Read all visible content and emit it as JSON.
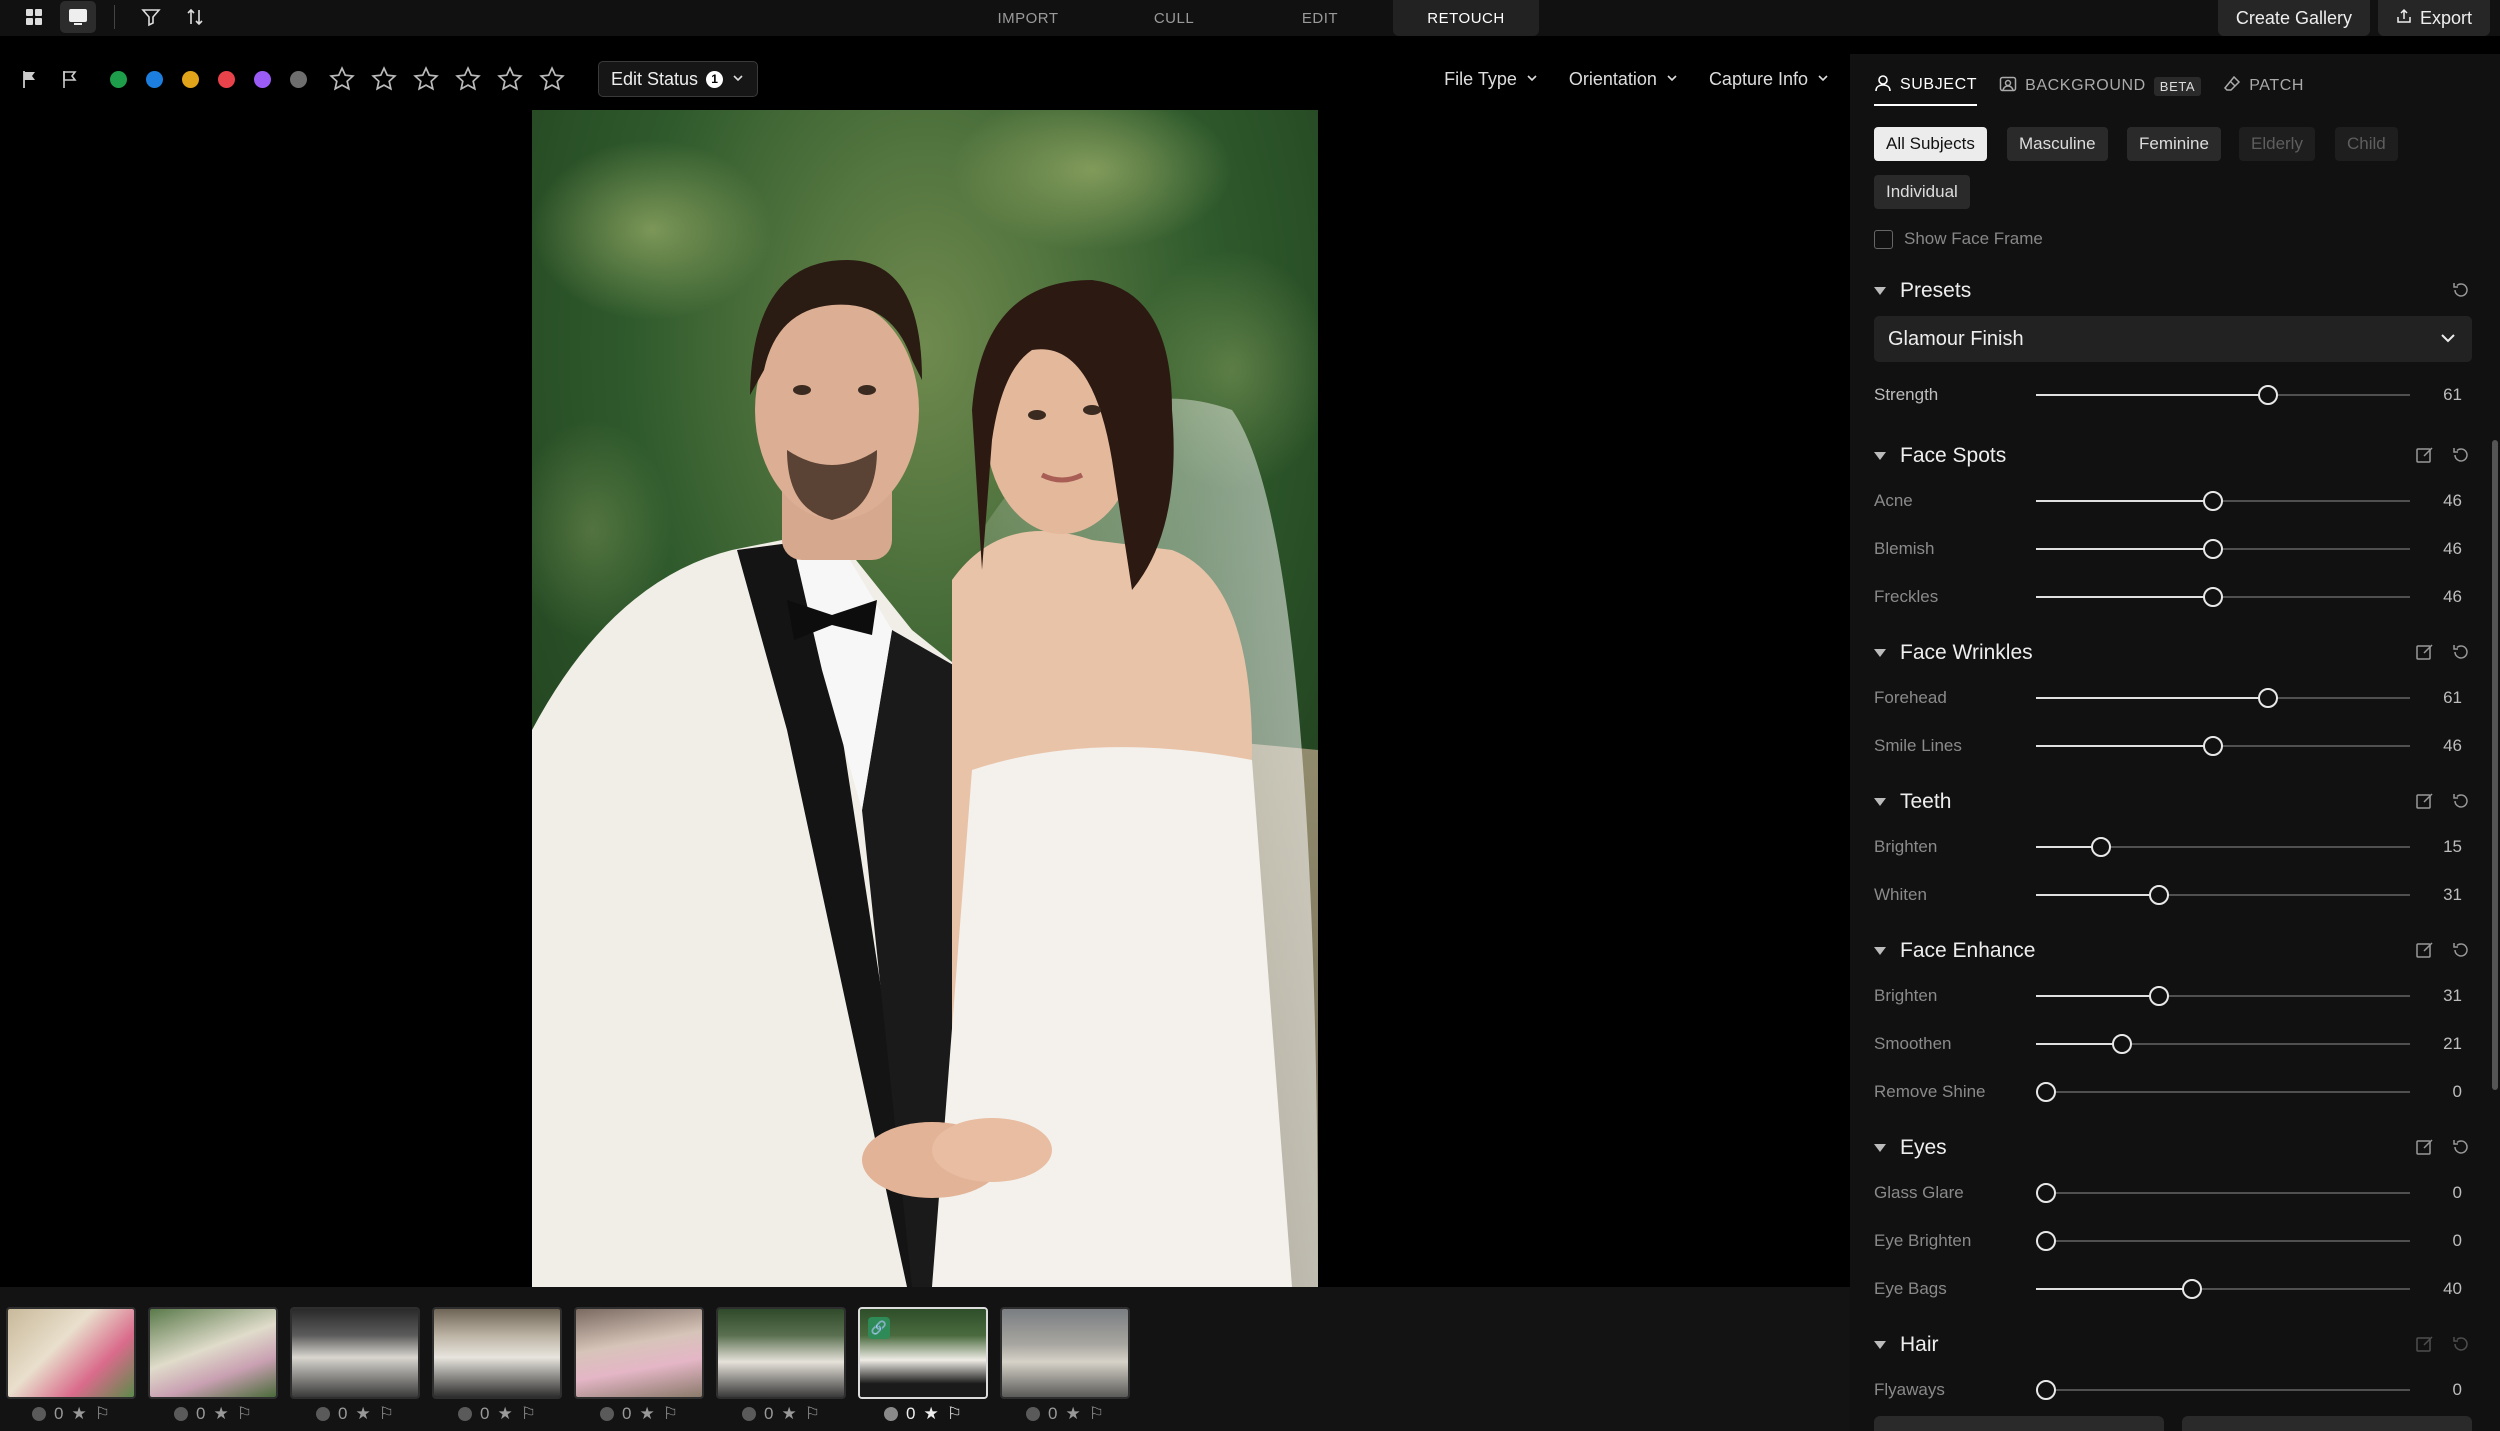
{
  "topbar": {
    "modes": [
      "IMPORT",
      "CULL",
      "EDIT",
      "RETOUCH"
    ],
    "active_mode": "RETOUCH",
    "create_gallery": "Create Gallery",
    "export": "Export"
  },
  "filterbar": {
    "color_labels": [
      "#1e9e4a",
      "#1c7fe0",
      "#e0a319",
      "#e8434a",
      "#9b5cf6",
      "#6e6e6e"
    ],
    "edit_status": "Edit Status",
    "edit_status_count": "1",
    "file_type": "File Type",
    "orientation": "Orientation",
    "capture_info": "Capture Info"
  },
  "filmstrip": {
    "thumbnails": [
      {
        "rating": "0",
        "active": false
      },
      {
        "rating": "0",
        "active": false
      },
      {
        "rating": "0",
        "active": false
      },
      {
        "rating": "0",
        "active": false
      },
      {
        "rating": "0",
        "active": false
      },
      {
        "rating": "0",
        "active": false
      },
      {
        "rating": "0",
        "active": true
      },
      {
        "rating": "0",
        "active": false
      }
    ]
  },
  "panel": {
    "tabs": {
      "subject": "SUBJECT",
      "background": "BACKGROUND",
      "beta": "BETA",
      "patch": "PATCH"
    },
    "subject_filters": {
      "all": "All Subjects",
      "masculine": "Masculine",
      "feminine": "Feminine",
      "elderly": "Elderly",
      "child": "Child",
      "individual": "Individual"
    },
    "show_face_frame": "Show Face Frame",
    "presets": {
      "title": "Presets",
      "selected": "Glamour Finish",
      "strength_label": "Strength",
      "strength": 61
    },
    "sections": {
      "face_spots": {
        "title": "Face Spots",
        "acne": {
          "label": "Acne",
          "value": 46
        },
        "blemish": {
          "label": "Blemish",
          "value": 46
        },
        "freckles": {
          "label": "Freckles",
          "value": 46
        }
      },
      "face_wrinkles": {
        "title": "Face Wrinkles",
        "forehead": {
          "label": "Forehead",
          "value": 61
        },
        "smile_lines": {
          "label": "Smile Lines",
          "value": 46
        }
      },
      "teeth": {
        "title": "Teeth",
        "brighten": {
          "label": "Brighten",
          "value": 15
        },
        "whiten": {
          "label": "Whiten",
          "value": 31
        }
      },
      "face_enhance": {
        "title": "Face Enhance",
        "brighten": {
          "label": "Brighten",
          "value": 31
        },
        "smoothen": {
          "label": "Smoothen",
          "value": 21
        },
        "remove_shine": {
          "label": "Remove Shine",
          "value": 0
        }
      },
      "eyes": {
        "title": "Eyes",
        "glass_glare": {
          "label": "Glass Glare",
          "value": 0
        },
        "eye_brighten": {
          "label": "Eye Brighten",
          "value": 0
        },
        "eye_bags": {
          "label": "Eye Bags",
          "value": 40
        }
      },
      "hair": {
        "title": "Hair",
        "flyaways": {
          "label": "Flyaways",
          "value": 0
        }
      }
    }
  }
}
